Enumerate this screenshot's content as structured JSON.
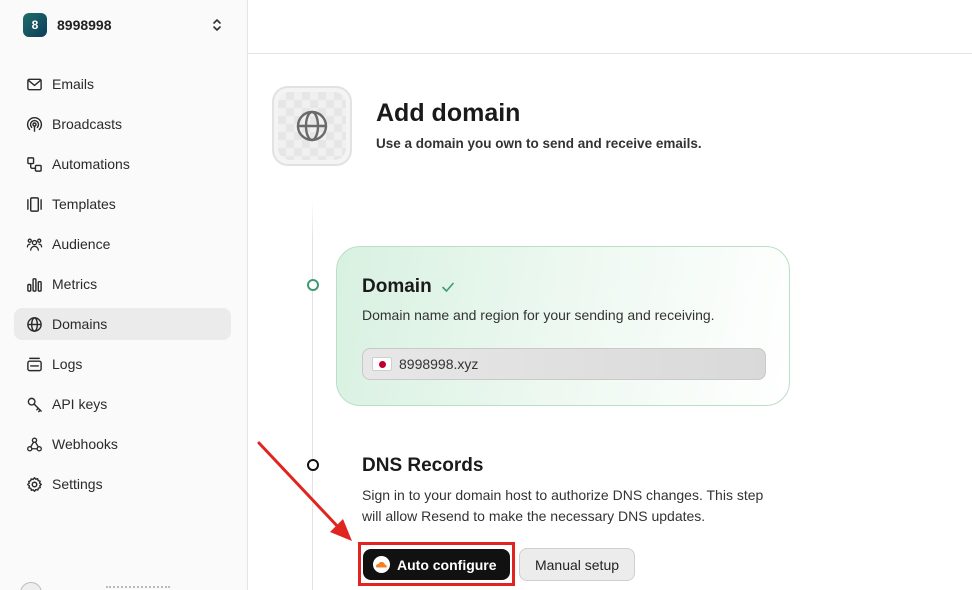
{
  "workspace": {
    "initial": "8",
    "name": "8998998"
  },
  "sidebar": {
    "items": [
      {
        "label": "Emails",
        "icon": "mail-icon",
        "active": false
      },
      {
        "label": "Broadcasts",
        "icon": "broadcast-icon",
        "active": false
      },
      {
        "label": "Automations",
        "icon": "automation-icon",
        "active": false
      },
      {
        "label": "Templates",
        "icon": "templates-icon",
        "active": false
      },
      {
        "label": "Audience",
        "icon": "audience-icon",
        "active": false
      },
      {
        "label": "Metrics",
        "icon": "metrics-icon",
        "active": false
      },
      {
        "label": "Domains",
        "icon": "globe-icon",
        "active": true
      },
      {
        "label": "Logs",
        "icon": "logs-icon",
        "active": false
      },
      {
        "label": "API keys",
        "icon": "key-icon",
        "active": false
      },
      {
        "label": "Webhooks",
        "icon": "webhook-icon",
        "active": false
      },
      {
        "label": "Settings",
        "icon": "gear-icon",
        "active": false
      }
    ]
  },
  "page": {
    "title": "Add domain",
    "subtitle": "Use a domain you own to send and receive emails.",
    "icon": "globe-icon"
  },
  "steps": {
    "domain": {
      "title": "Domain",
      "status_icon": "check-icon",
      "description": "Domain name and region for your sending and receiving.",
      "value": "8998998.xyz",
      "region_flag": "japan-flag-icon"
    },
    "dns": {
      "title": "DNS Records",
      "description": "Sign in to your domain host to authorize DNS changes. This step will allow Resend to make the necessary DNS updates.",
      "auto_label": "Auto configure",
      "auto_icon": "cloudflare-icon",
      "manual_label": "Manual setup"
    }
  },
  "colors": {
    "accent_green": "#3f9a72",
    "highlight_red": "#e0241f",
    "primary_button": "#111111"
  }
}
